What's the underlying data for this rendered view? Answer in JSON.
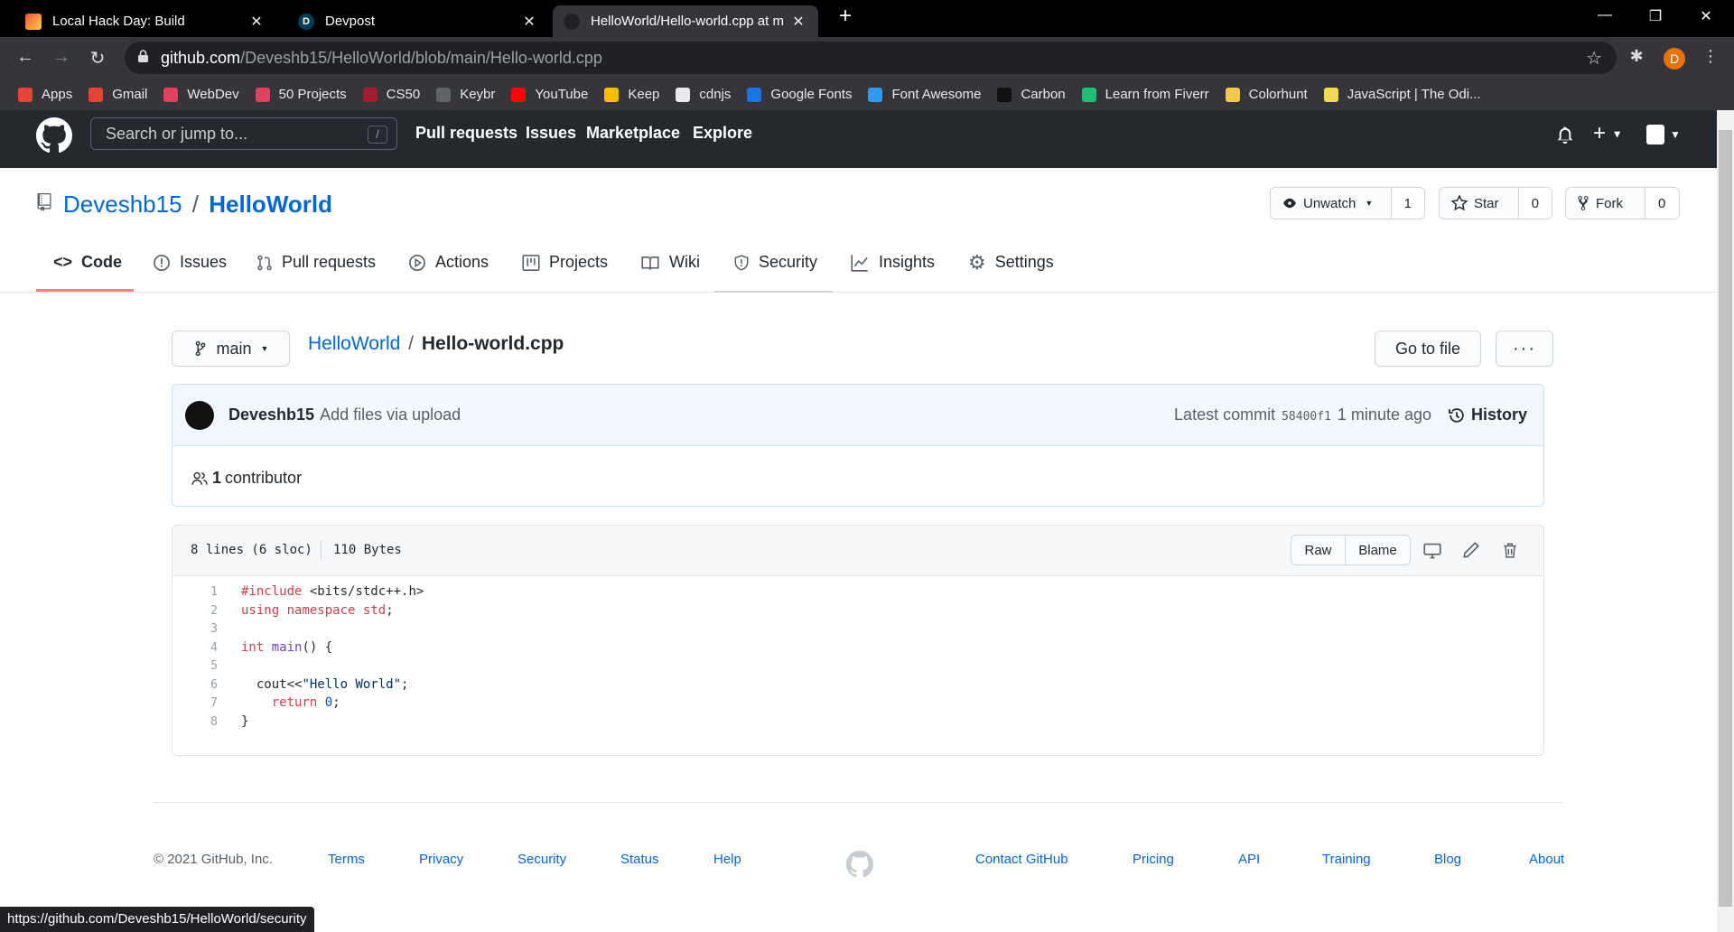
{
  "browser": {
    "tabs": [
      {
        "title": "Local Hack Day: Build",
        "active": false
      },
      {
        "title": "Devpost",
        "active": false
      },
      {
        "title": "HelloWorld/Hello-world.cpp at m",
        "active": true
      }
    ],
    "url_host": "github.com",
    "url_path": "/Deveshb15/HelloWorld/blob/main/Hello-world.cpp",
    "profile_initial": "D",
    "bookmarks": [
      {
        "label": "Apps",
        "color": "#ea4335"
      },
      {
        "label": "Gmail",
        "color": "#ea4335"
      },
      {
        "label": "WebDev",
        "color": "#e4405f"
      },
      {
        "label": "50 Projects",
        "color": "#e4405f"
      },
      {
        "label": "CS50",
        "color": "#a51c30"
      },
      {
        "label": "Keybr",
        "color": "#5f6368"
      },
      {
        "label": "YouTube",
        "color": "#ff0000"
      },
      {
        "label": "Keep",
        "color": "#fbbc04"
      },
      {
        "label": "cdnjs",
        "color": "#e8eaed"
      },
      {
        "label": "Google Fonts",
        "color": "#1a73e8"
      },
      {
        "label": "Font Awesome",
        "color": "#339af0"
      },
      {
        "label": "Carbon",
        "color": "#111111"
      },
      {
        "label": "Learn from Fiverr",
        "color": "#1dbf73"
      },
      {
        "label": "Colorhunt",
        "color": "#f2c94c"
      },
      {
        "label": "JavaScript | The Odi...",
        "color": "#f0db4f"
      }
    ]
  },
  "github": {
    "search_placeholder": "Search or jump to...",
    "search_key": "/",
    "nav": [
      "Pull requests",
      "Issues",
      "Marketplace",
      "Explore"
    ]
  },
  "repo": {
    "owner": "Deveshb15",
    "separator": "/",
    "name": "HelloWorld",
    "watch_label": "Unwatch",
    "watch_count": "1",
    "star_label": "Star",
    "star_count": "0",
    "fork_label": "Fork",
    "fork_count": "0",
    "tabs": [
      "Code",
      "Issues",
      "Pull requests",
      "Actions",
      "Projects",
      "Wiki",
      "Security",
      "Insights",
      "Settings"
    ]
  },
  "file": {
    "branch": "main",
    "crumb_repo": "HelloWorld",
    "crumb_sep": "/",
    "crumb_file": "Hello-world.cpp",
    "go_to_file": "Go to file",
    "more": "···",
    "commit_author": "Deveshb15",
    "commit_message": "Add files via upload",
    "latest_commit_label": "Latest commit",
    "commit_sha": "58400f1",
    "commit_time": "1 minute ago",
    "history_label": "History",
    "contributor_count": "1",
    "contributor_label": "contributor",
    "lines_info": "8 lines (6 sloc)",
    "size_info": "110 Bytes",
    "raw_label": "Raw",
    "blame_label": "Blame",
    "code": [
      {
        "n": "1",
        "text": "#include <bits/stdc++.h>"
      },
      {
        "n": "2",
        "text": "using namespace std;"
      },
      {
        "n": "3",
        "text": ""
      },
      {
        "n": "4",
        "text": "int main() {"
      },
      {
        "n": "5",
        "text": ""
      },
      {
        "n": "6",
        "text": "  cout<<\"Hello World\";"
      },
      {
        "n": "7",
        "text": "    return 0;"
      },
      {
        "n": "8",
        "text": "}"
      }
    ]
  },
  "footer": {
    "copyright": "© 2021 GitHub, Inc.",
    "left_links": [
      "Terms",
      "Privacy",
      "Security",
      "Status",
      "Help"
    ],
    "right_links": [
      "Contact GitHub",
      "Pricing",
      "API",
      "Training",
      "Blog",
      "About"
    ]
  },
  "status_url": "https://github.com/Deveshb15/HelloWorld/security"
}
